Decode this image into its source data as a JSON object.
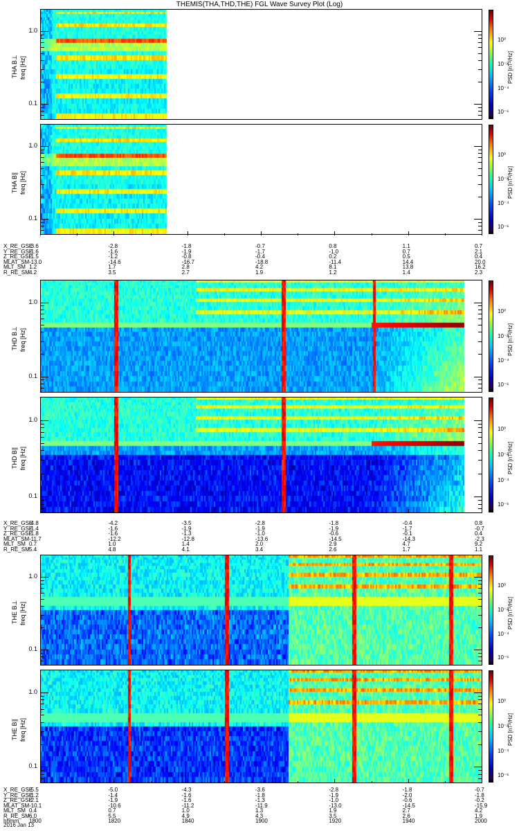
{
  "title": "THEMIS(THA,THD,THE) FGL Wave Survey Plot (Log)",
  "chart_data": {
    "type": "heatmap",
    "title": "THEMIS(THA,THD,THE) FGL Wave Survey Plot (Log)",
    "xlabel": "hhmm",
    "date": "2016 Jan 13",
    "xlim": [
      "1800",
      "2000"
    ],
    "x_ticks": [
      "1800",
      "1820",
      "1840",
      "1900",
      "1920",
      "1940",
      "2000"
    ],
    "ylim_hz": [
      0.06,
      2.0
    ],
    "yscale": "log",
    "zscale": "log",
    "panels": [
      {
        "probe": "THA",
        "component": "B⊥",
        "ylabel": "THA B⊥",
        "yunit": "freq [Hz]",
        "y_ticks": [
          "1.0",
          "0.1"
        ],
        "data_end": "1834",
        "colorbar": {
          "label": "PSD [nT²/Hz]",
          "ticks": [
            "10⁰",
            "10⁻²",
            "10⁻⁴",
            "10⁻⁶"
          ]
        }
      },
      {
        "probe": "THA",
        "component": "B∥",
        "ylabel": "THA B∥",
        "yunit": "freq [Hz]",
        "y_ticks": [
          "1.0",
          "0.1"
        ],
        "data_end": "1834",
        "colorbar": {
          "label": "PSD [nT²/Hz]",
          "ticks": [
            "10⁰",
            "10⁻²",
            "10⁻⁴",
            "10⁻⁶"
          ]
        }
      },
      {
        "probe": "THD",
        "component": "B⊥",
        "ylabel": "THD B⊥",
        "yunit": "freq [Hz]",
        "y_ticks": [
          "1.0",
          "0.1"
        ],
        "data_end": "1955",
        "colorbar": {
          "label": "PSD [nT²/Hz]",
          "ticks": [
            "10⁰",
            "10⁻²",
            "10⁻⁴",
            "10⁻⁶"
          ]
        }
      },
      {
        "probe": "THD",
        "component": "B∥",
        "ylabel": "THD B∥",
        "yunit": "freq [Hz]",
        "y_ticks": [
          "1.0",
          "0.1"
        ],
        "data_end": "1955",
        "colorbar": {
          "label": "PSD [nT²/Hz]",
          "ticks": [
            "10⁰",
            "10⁻²",
            "10⁻⁴",
            "10⁻⁶"
          ]
        }
      },
      {
        "probe": "THE",
        "component": "B⊥",
        "ylabel": "THE B⊥",
        "yunit": "freq [Hz]",
        "y_ticks": [
          "1.0",
          "0.1"
        ],
        "data_end": "2000",
        "colorbar": {
          "label": "PSD [nT²/Hz]",
          "ticks": [
            "10⁰",
            "10⁻²",
            "10⁻⁴",
            "10⁻⁶"
          ]
        }
      },
      {
        "probe": "THE",
        "component": "B∥",
        "ylabel": "THE B∥",
        "yunit": "freq [Hz]",
        "y_ticks": [
          "1.0",
          "0.1"
        ],
        "data_end": "2000",
        "colorbar": {
          "label": "PSD [nT²/Hz]",
          "ticks": [
            "10⁰",
            "10⁻²",
            "10⁻⁴",
            "10⁻⁶"
          ]
        }
      }
    ]
  },
  "ephemeris": [
    {
      "probe": "THA",
      "rows": [
        {
          "label": "X_RE_GSE",
          "values": [
            "-3.6",
            "-2.8",
            "-1.8",
            "-0.7",
            "0.8",
            "1.1",
            "0.7"
          ]
        },
        {
          "label": "Y_RE_GSE",
          "values": [
            "-1.6",
            "-1.6",
            "-1.9",
            "-1.7",
            "-1.0",
            "0.7",
            "2.1"
          ]
        },
        {
          "label": "Z_RE_GSE",
          "values": [
            "-1.5",
            "-1.2",
            "-0.8",
            "-0.4",
            "0.2",
            "0.5",
            "0.4"
          ]
        },
        {
          "label": "MLAT_SM",
          "values": [
            "-13.0",
            "-14.6",
            "-16.7",
            "-18.8",
            "-11.4",
            "14.4",
            "20.0"
          ]
        },
        {
          "label": "MLT_SM",
          "values": [
            "1.2",
            "1.7",
            "2.8",
            "4.2",
            "8.1",
            "13.8",
            "16.2"
          ]
        },
        {
          "label": "R_RE_SM",
          "values": [
            "4.2",
            "3.5",
            "2.7",
            "1.9",
            "1.2",
            "1.4",
            "2.3"
          ]
        }
      ]
    },
    {
      "probe": "THD",
      "rows": [
        {
          "label": "X_RE_GSE",
          "values": [
            "-4.8",
            "-4.2",
            "-3.5",
            "-2.8",
            "-1.8",
            "-0.4",
            "0.8"
          ]
        },
        {
          "label": "Y_RE_GSE",
          "values": [
            "-1.4",
            "-1.6",
            "-1.9",
            "-1.9",
            "-1.9",
            "-1.7",
            "-0.7"
          ]
        },
        {
          "label": "Z_RE_GSE",
          "values": [
            "-1.8",
            "-1.6",
            "-1.3",
            "-1.0",
            "-0.6",
            "-0.1",
            "0.4"
          ]
        },
        {
          "label": "MLAT_SM",
          "values": [
            "-11.7",
            "-12.2",
            "-12.8",
            "-13.6",
            "-14.5",
            "-14.3",
            "-2.3"
          ]
        },
        {
          "label": "MLT_SM",
          "values": [
            "0.7",
            "1.0",
            "1.4",
            "2.0",
            "2.9",
            "4.7",
            "9.2"
          ]
        },
        {
          "label": "R_RE_SM",
          "values": [
            "5.4",
            "4.8",
            "4.1",
            "3.4",
            "2.6",
            "1.7",
            "1.1"
          ]
        }
      ]
    },
    {
      "probe": "THE",
      "rows": [
        {
          "label": "X_RE_GSE",
          "values": [
            "-5.5",
            "-5.0",
            "-4.3",
            "-3.6",
            "-2.8",
            "-1.8",
            "-0.7"
          ]
        },
        {
          "label": "Y_RE_GSE",
          "values": [
            "-1.2",
            "-1.4",
            "-1.6",
            "-1.8",
            "-1.9",
            "-2.0",
            "-1.8"
          ]
        },
        {
          "label": "Z_RE_GSE",
          "values": [
            "-2.1",
            "-1.9",
            "-1.6",
            "-1.3",
            "-1.0",
            "-0.6",
            "-0.2"
          ]
        },
        {
          "label": "MLAT_SM",
          "values": [
            "-10.1",
            "-10.6",
            "-11.2",
            "-11.9",
            "-13.0",
            "-14.5",
            "-15.9"
          ]
        },
        {
          "label": "MLT_SM",
          "values": [
            "0.4",
            "0.7",
            "1.0",
            "1.3",
            "1.9",
            "2.7",
            "4.2"
          ]
        },
        {
          "label": "R_RE_SM",
          "values": [
            "6.0",
            "5.5",
            "4.9",
            "4.3",
            "3.5",
            "2.6",
            "1.9"
          ]
        },
        {
          "label": "hhmm",
          "values": [
            "1800",
            "1820",
            "1840",
            "1900",
            "1920",
            "1940",
            "2000"
          ]
        }
      ]
    }
  ]
}
